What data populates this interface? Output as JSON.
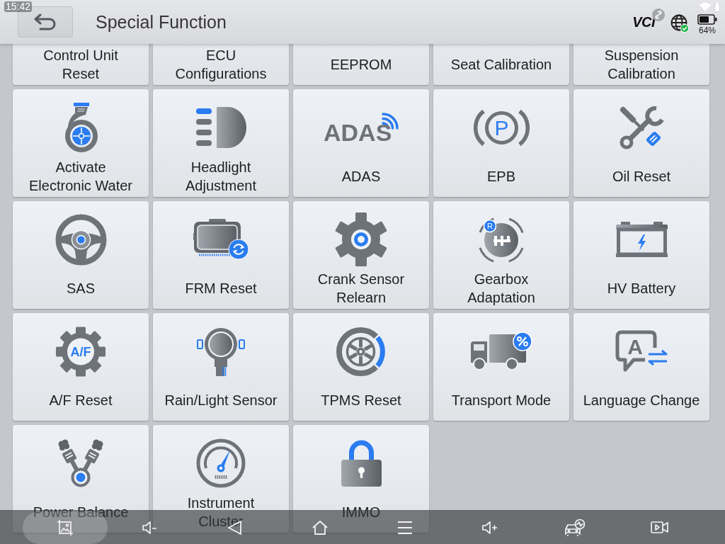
{
  "status_bar": {
    "time": "15:42"
  },
  "header": {
    "title": "Special Function",
    "vci_logo": "VCI",
    "battery": "64%"
  },
  "function_grid": {
    "partial_row": [
      {
        "label": "Control Unit\nReset"
      },
      {
        "label": "ECU\nConfigurations"
      },
      {
        "label": "EEPROM"
      },
      {
        "label": "Seat Calibration"
      },
      {
        "label": "Suspension\nCalibration"
      }
    ],
    "items": [
      {
        "label": "Activate\nElectronic Water"
      },
      {
        "label": "Headlight\nAdjustment"
      },
      {
        "label": "ADAS",
        "icon_text": "ADAS"
      },
      {
        "label": "EPB",
        "icon_text": "P"
      },
      {
        "label": "Oil Reset"
      },
      {
        "label": "SAS"
      },
      {
        "label": "FRM Reset"
      },
      {
        "label": "Crank Sensor\nRelearn"
      },
      {
        "label": "Gearbox\nAdaptation",
        "icon_text": "R"
      },
      {
        "label": "HV Battery"
      },
      {
        "label": "A/F Reset",
        "icon_text": "A/F"
      },
      {
        "label": "Rain/Light Sensor"
      },
      {
        "label": "TPMS Reset"
      },
      {
        "label": "Transport Mode"
      },
      {
        "label": "Language Change",
        "icon_text": "A"
      },
      {
        "label": "Power Balance"
      },
      {
        "label": "Instrument\nCluster"
      },
      {
        "label": "IMMO"
      }
    ]
  },
  "nav_bar": [
    {
      "pressed": true
    },
    {
      "pressed": false
    },
    {
      "pressed": false
    },
    {
      "pressed": false
    },
    {
      "pressed": false
    },
    {
      "pressed": false
    },
    {
      "pressed": false
    },
    {
      "pressed": false
    }
  ]
}
